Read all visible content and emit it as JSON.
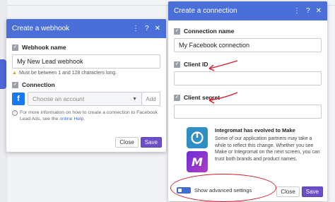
{
  "webhook_dialog": {
    "title": "Create a webhook",
    "header_icons": [
      "more-icon",
      "help-icon",
      "close-icon"
    ],
    "webhook_name_label": "Webhook name",
    "webhook_name_value": "My New Lead webhook",
    "webhook_name_hint": "Must be between 1 and 128 characters long.",
    "connection_label": "Connection",
    "connection_placeholder": "Choose an account",
    "add_label": "Add",
    "help_prefix": "For more information on how to create a connection to Facebook Lead Ads, see the",
    "help_link": "online Help",
    "help_suffix": ".",
    "close_label": "Close",
    "save_label": "Save"
  },
  "connection_dialog": {
    "title": "Create a connection",
    "header_icons": [
      "more-icon",
      "help-icon",
      "close-icon"
    ],
    "connection_name_label": "Connection name",
    "connection_name_value": "My Facebook connection",
    "client_id_label": "Client ID",
    "client_id_value": "",
    "client_secret_label": "Client secret",
    "client_secret_value": "",
    "promo_title": "Integromat has evolved to Make",
    "promo_body": "Some of our application partners may take a while to reflect this change. Whether you see Make or Integromat on the next screen, you can trust both brands and product names.",
    "advanced_label": "Show advanced settings",
    "close_label": "Close",
    "save_label": "Save"
  },
  "colors": {
    "header_blue": "#4a6fd9",
    "save_purple": "#6a4fc7",
    "annotation_red": "#d61e2a",
    "facebook_blue": "#1877f2"
  }
}
